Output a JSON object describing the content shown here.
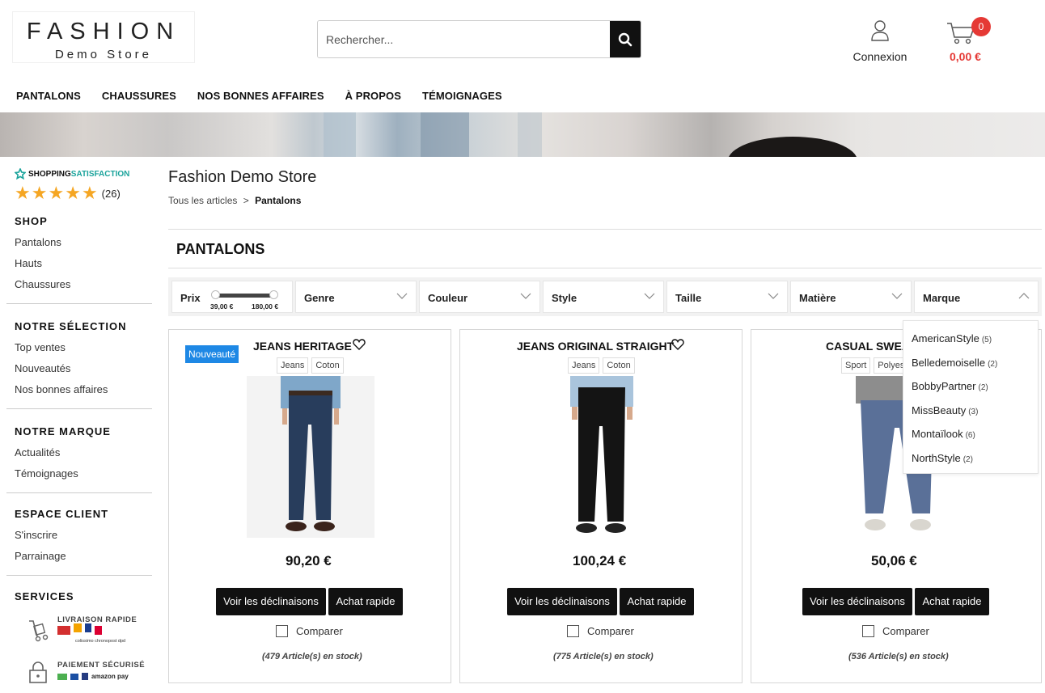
{
  "header": {
    "logo_line1": "FASHION",
    "logo_line2": "Demo Store",
    "search_placeholder": "Rechercher...",
    "account_label": "Connexion",
    "cart_count": "0",
    "cart_total": "0,00 €"
  },
  "nav": [
    "PANTALONS",
    "CHAUSSURES",
    "NOS BONNES AFFAIRES",
    "À PROPOS",
    "TÉMOIGNAGES"
  ],
  "sidebar": {
    "badge_part1": "SHOPPING",
    "badge_part2": "SATISFACTION",
    "rating_count": "(26)",
    "rating_stars": 5,
    "shop_title": "SHOP",
    "shop_items": [
      "Pantalons",
      "Hauts",
      "Chaussures"
    ],
    "selection_title": "NOTRE SÉLECTION",
    "selection_items": [
      "Top ventes",
      "Nouveautés",
      "Nos bonnes affaires"
    ],
    "brand_title": "NOTRE MARQUE",
    "brand_items": [
      "Actualités",
      "Témoignages"
    ],
    "client_title": "ESPACE CLIENT",
    "client_items": [
      "S'inscrire",
      "Parrainage"
    ],
    "services_title": "SERVICES",
    "service1": "LIVRAISON RAPIDE",
    "service2": "PAIEMENT SÉCURISÉ",
    "service1_logos": [
      "colissimo",
      "chronopost",
      "dpd"
    ],
    "service2_logos": [
      "amazon pay"
    ]
  },
  "main": {
    "store_title": "Fashion Demo Store",
    "breadcrumb_root": "Tous les articles",
    "breadcrumb_sep": ">",
    "breadcrumb_current": "Pantalons",
    "category_title": "PANTALONS"
  },
  "filters": {
    "price_label": "Prix",
    "price_min": "39,00 €",
    "price_max": "180,00 €",
    "labels": [
      "Genre",
      "Couleur",
      "Style",
      "Taille",
      "Matière",
      "Marque"
    ]
  },
  "brand_dropdown": [
    {
      "name": "AmericanStyle",
      "count": "(5)"
    },
    {
      "name": "Belledemoiselle",
      "count": "(2)"
    },
    {
      "name": "BobbyPartner",
      "count": "(2)"
    },
    {
      "name": "MissBeauty",
      "count": "(3)"
    },
    {
      "name": "Montaïlook",
      "count": "(6)"
    },
    {
      "name": "NorthStyle",
      "count": "(2)"
    }
  ],
  "products": [
    {
      "badge": "Nouveauté",
      "name": "JEANS HERITAGE",
      "tags": [
        "Jeans",
        "Coton"
      ],
      "price": "90,20 €",
      "btn_variants": "Voir les déclinaisons",
      "btn_quick": "Achat rapide",
      "compare": "Comparer",
      "stock": "(479 Article(s) en stock)"
    },
    {
      "badge": "",
      "name": "JEANS ORIGINAL STRAIGHT",
      "tags": [
        "Jeans",
        "Coton"
      ],
      "price": "100,24 €",
      "btn_variants": "Voir les déclinaisons",
      "btn_quick": "Achat rapide",
      "compare": "Comparer",
      "stock": "(775 Article(s) en stock)"
    },
    {
      "badge": "",
      "name": "CASUAL SWEAT",
      "tags": [
        "Sport",
        "Polyes"
      ],
      "price": "50,06 €",
      "btn_variants": "Voir les déclinaisons",
      "btn_quick": "Achat rapide",
      "compare": "Comparer",
      "stock": "(536 Article(s) en stock)"
    }
  ],
  "colors": {
    "accent_red": "#e53935",
    "new_badge_blue": "#1e88e5",
    "star": "#f5a623",
    "satisfaction_green": "#1aa39b"
  }
}
